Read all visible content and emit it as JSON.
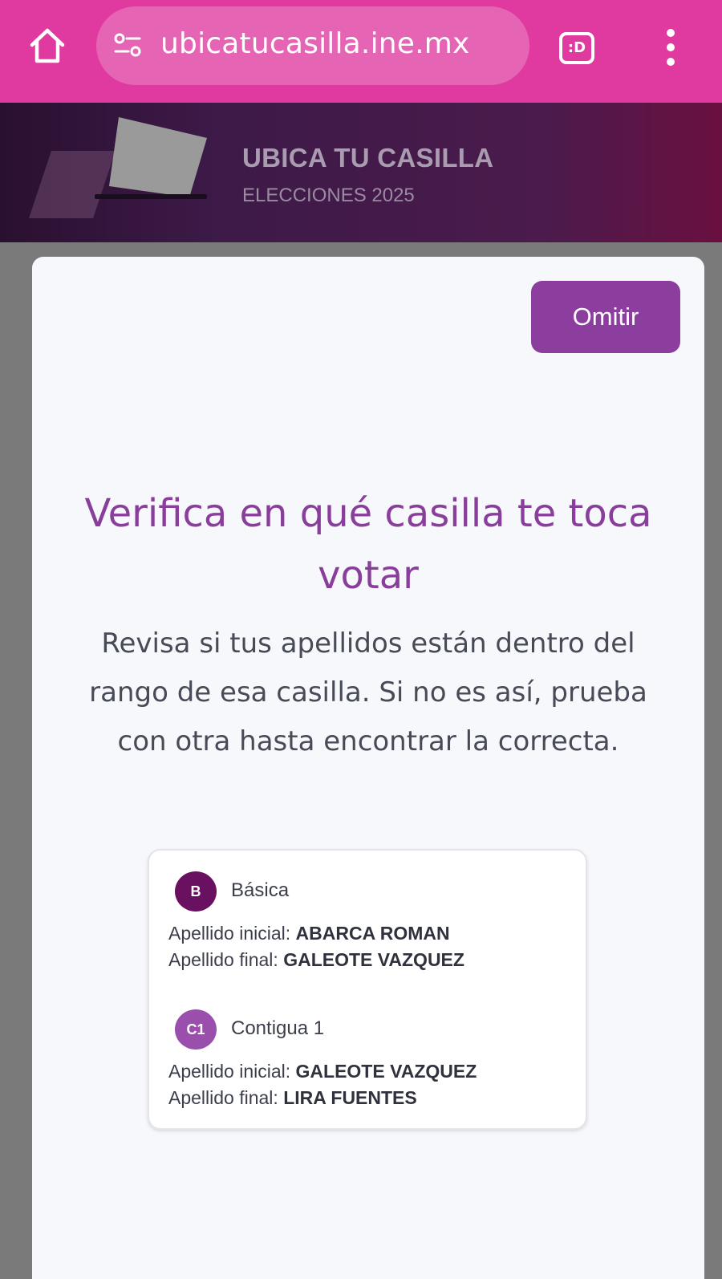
{
  "browser": {
    "url": "ubicatucasilla.ine.mx",
    "extension_label": ":D",
    "colors": {
      "toolbar": "#e0399f",
      "url_pill": "#e565b4"
    }
  },
  "site_header": {
    "title": "UBICA TU CASILLA",
    "subtitle": "ELECCIONES 2025"
  },
  "modal": {
    "skip_label": "Omitir",
    "title": "Verifica en qué casilla te toca votar",
    "text": "Revisa si tus apellidos están dentro del rango de esa casilla. Si no es así, prueba con otra hasta encontrar la correcta.",
    "example": [
      {
        "badge": "B",
        "type": "Básica",
        "start_label": "Apellido inicial:",
        "start_value": "ABARCA ROMAN",
        "end_label": "Apellido final:",
        "end_value": "GALEOTE VAZQUEZ"
      },
      {
        "badge": "C1",
        "type": "Contigua 1",
        "start_label": "Apellido inicial:",
        "start_value": "GALEOTE VAZQUEZ",
        "end_label": "Apellido final:",
        "end_value": "LIRA FUENTES"
      }
    ],
    "colors": {
      "accent": "#8b3e9e",
      "badge_basic": "#6a1060",
      "badge_contigua": "#9b4fad"
    }
  }
}
